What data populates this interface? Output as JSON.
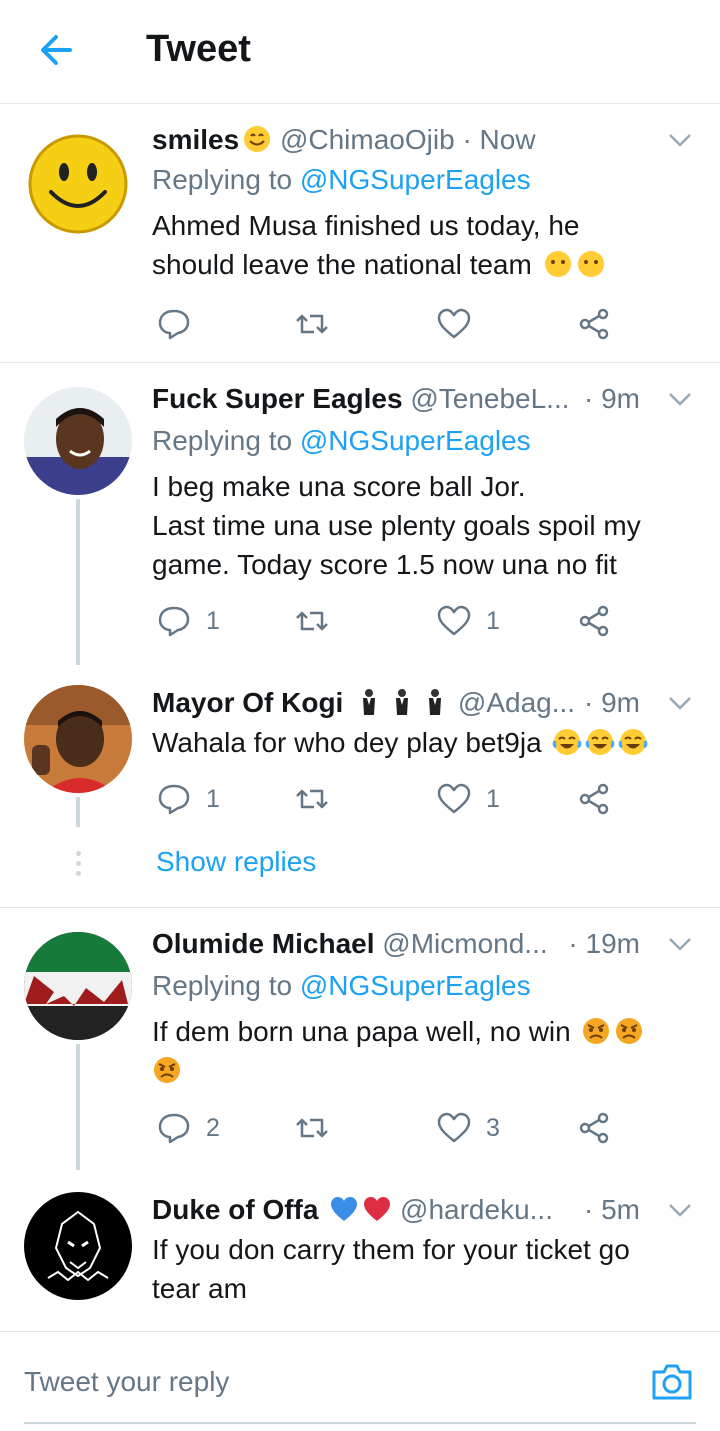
{
  "header": {
    "title": "Tweet"
  },
  "tweets": [
    {
      "name": "smiles",
      "handle": "@ChimaoOjib",
      "sep_time": "· Now",
      "replying_prefix": "Replying to ",
      "replying_to": "@NGSuperEagles",
      "text_1": "Ahmed Musa finished us today, he",
      "text_2": "should leave the national team",
      "reply_count": "",
      "retweet_count": "",
      "like_count": ""
    },
    {
      "name": "Fuck Super Eagles",
      "handle": "@TenebeL...",
      "sep_time": "· 9m",
      "replying_prefix": "Replying to ",
      "replying_to": "@NGSuperEagles",
      "text_1": "I beg make una score ball Jor.",
      "text_2": "Last time una use plenty goals spoil my",
      "text_3": "game. Today score 1.5 now una no fit",
      "reply_count": "1",
      "like_count": "1"
    },
    {
      "name": "Mayor Of Kogi",
      "handle": "@Adag...",
      "sep_time": "· 9m",
      "text_1": "Wahala for who dey play bet9ja",
      "reply_count": "1",
      "like_count": "1",
      "show_replies": "Show replies"
    },
    {
      "name": "Olumide Michael",
      "handle": "@Micmond...",
      "sep_time": "· 19m",
      "replying_prefix": "Replying to ",
      "replying_to": "@NGSuperEagles",
      "text_1": "If dem born una papa well, no win",
      "reply_count": "2",
      "like_count": "3"
    },
    {
      "name": "Duke of Offa",
      "handle": "@hardeku...",
      "sep_time": "· 5m",
      "text_1": "If you don carry them for your ticket go",
      "text_2": "tear am"
    }
  ],
  "reply_bar": {
    "placeholder": "Tweet your reply"
  },
  "colors": {
    "accent": "#1da1f2",
    "secondary_text": "#657786",
    "border": "#e1e8ed"
  }
}
